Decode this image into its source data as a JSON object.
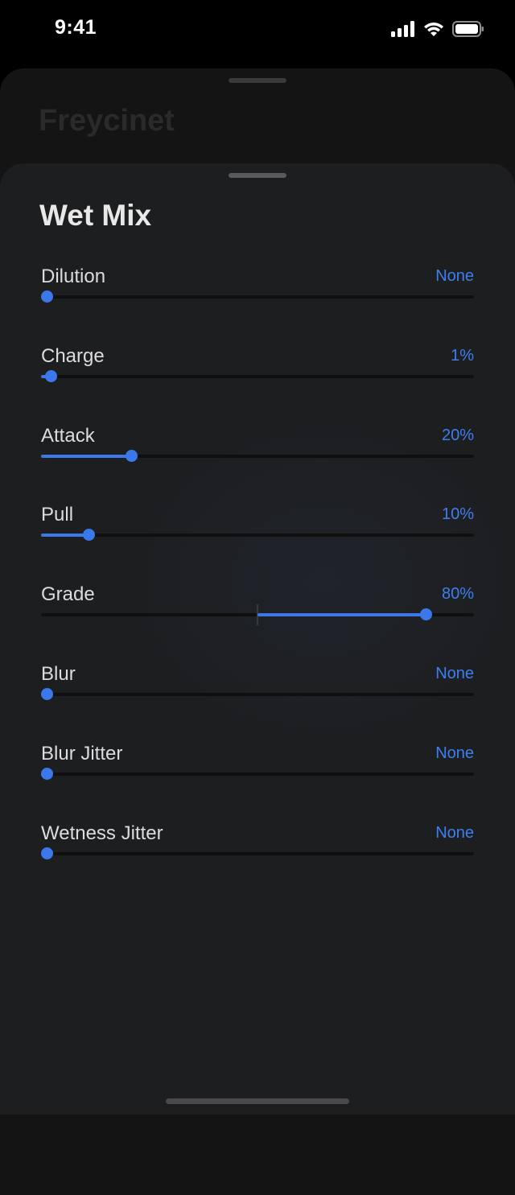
{
  "status_bar": {
    "time": "9:41"
  },
  "background_sheet": {
    "title": "Freycinet"
  },
  "sheet": {
    "title": "Wet Mix",
    "sliders": [
      {
        "label": "Dilution",
        "value_text": "None",
        "level": 0,
        "centered": false
      },
      {
        "label": "Charge",
        "value_text": "1%",
        "level": 0.01,
        "centered": false
      },
      {
        "label": "Attack",
        "value_text": "20%",
        "level": 0.2,
        "centered": false
      },
      {
        "label": "Pull",
        "value_text": "10%",
        "level": 0.1,
        "centered": false
      },
      {
        "label": "Grade",
        "value_text": "80%",
        "level": 0.8,
        "centered": true
      },
      {
        "label": "Blur",
        "value_text": "None",
        "level": 0,
        "centered": false
      },
      {
        "label": "Blur Jitter",
        "value_text": "None",
        "level": 0,
        "centered": false
      },
      {
        "label": "Wetness Jitter",
        "value_text": "None",
        "level": 0,
        "centered": false
      }
    ]
  },
  "colors": {
    "accent": "#3a78ec",
    "value_text": "#3f7ef0",
    "sheet_bg": "#1d1d1f"
  },
  "icons": [
    "signal-bars-icon",
    "wifi-icon",
    "battery-icon"
  ]
}
